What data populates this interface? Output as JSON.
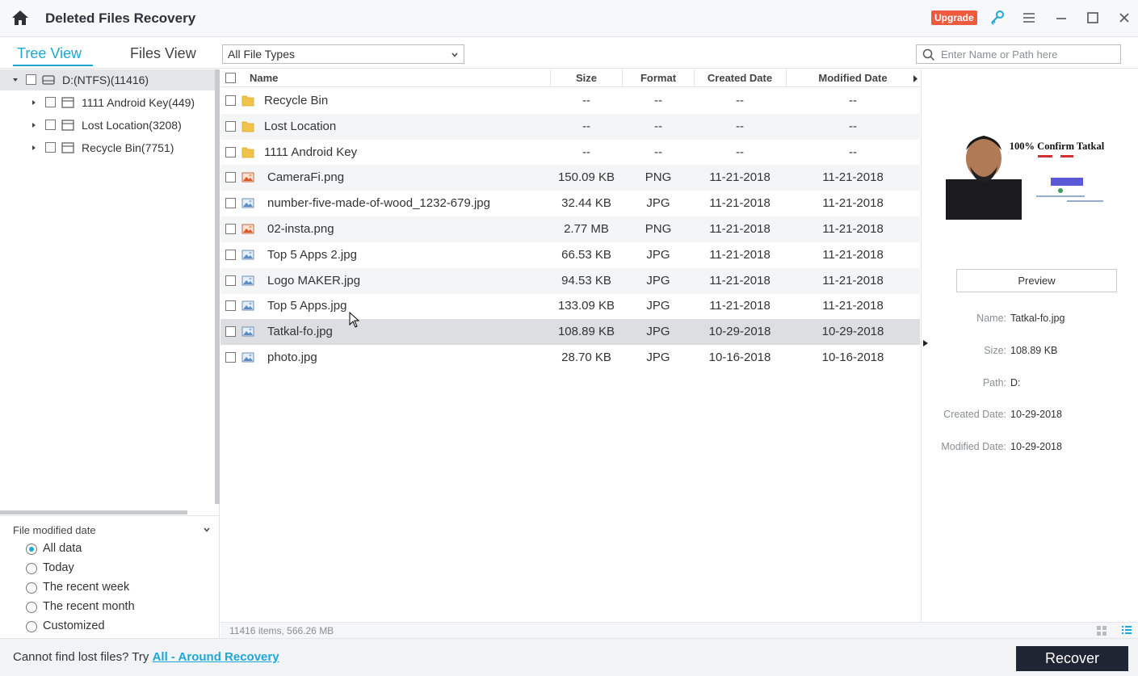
{
  "titlebar": {
    "title": "Deleted Files Recovery",
    "upgrade_label": "Upgrade",
    "icons": [
      "home-icon",
      "key-icon",
      "menu-icon",
      "minimize-icon",
      "maximize-icon",
      "close-icon"
    ]
  },
  "toolbar": {
    "tabs": [
      {
        "label": "Tree View",
        "active": true
      },
      {
        "label": "Files View",
        "active": false
      }
    ],
    "file_type_filter": "All File Types",
    "search_placeholder": "Enter Name or Path here"
  },
  "tree": [
    {
      "label": "D:(NTFS)(11416)",
      "expanded": true,
      "selected": true
    },
    {
      "label": "1111   Android Key(449)",
      "expanded": false
    },
    {
      "label": "Lost Location(3208)",
      "expanded": false
    },
    {
      "label": "Recycle Bin(7751)",
      "expanded": false
    }
  ],
  "filter": {
    "title": "File modified date",
    "options": [
      {
        "label": "All data",
        "selected": true
      },
      {
        "label": "Today",
        "selected": false
      },
      {
        "label": "The recent week",
        "selected": false
      },
      {
        "label": "The recent month",
        "selected": false
      },
      {
        "label": "Customized",
        "selected": false
      }
    ]
  },
  "list": {
    "columns": [
      "Name",
      "Size",
      "Format",
      "Created Date",
      "Modified Date"
    ],
    "rows": [
      {
        "name": "Recycle Bin",
        "size": "--",
        "format": "--",
        "created": "--",
        "modified": "--",
        "icon": "folder-icon"
      },
      {
        "name": "Lost Location",
        "size": "--",
        "format": "--",
        "created": "--",
        "modified": "--",
        "icon": "folder-icon"
      },
      {
        "name": "1111   Android Key",
        "size": "--",
        "format": "--",
        "created": "--",
        "modified": "--",
        "icon": "folder-icon"
      },
      {
        "name": "CameraFi.png",
        "size": "150.09 KB",
        "format": "PNG",
        "created": "11-21-2018",
        "modified": "11-21-2018",
        "icon": "png-image-icon"
      },
      {
        "name": "number-five-made-of-wood_1232-679.jpg",
        "size": "32.44 KB",
        "format": "JPG",
        "created": "11-21-2018",
        "modified": "11-21-2018",
        "icon": "jpg-image-icon"
      },
      {
        "name": "02-insta.png",
        "size": "2.77 MB",
        "format": "PNG",
        "created": "11-21-2018",
        "modified": "11-21-2018",
        "icon": "png-image-icon"
      },
      {
        "name": "Top 5 Apps 2.jpg",
        "size": "66.53 KB",
        "format": "JPG",
        "created": "11-21-2018",
        "modified": "11-21-2018",
        "icon": "jpg-image-icon"
      },
      {
        "name": "Logo MAKER.jpg",
        "size": "94.53 KB",
        "format": "JPG",
        "created": "11-21-2018",
        "modified": "11-21-2018",
        "icon": "jpg-image-icon"
      },
      {
        "name": "Top 5 Apps.jpg",
        "size": "133.09 KB",
        "format": "JPG",
        "created": "11-21-2018",
        "modified": "11-21-2018",
        "icon": "jpg-image-icon"
      },
      {
        "name": "Tatkal-fo.jpg",
        "size": "108.89 KB",
        "format": "JPG",
        "created": "10-29-2018",
        "modified": "10-29-2018",
        "icon": "jpg-image-icon",
        "selected": true
      },
      {
        "name": "photo.jpg",
        "size": "28.70 KB",
        "format": "JPG",
        "created": "10-16-2018",
        "modified": "10-16-2018",
        "icon": "jpg-image-icon"
      }
    ],
    "status": "11416 items, 566.26 MB"
  },
  "preview": {
    "thumbnail_text": "100% Confirm Tatkal",
    "button_label": "Preview",
    "meta": [
      {
        "key": "Name:",
        "value": "Tatkal-fo.jpg"
      },
      {
        "key": "Size:",
        "value": "108.89 KB"
      },
      {
        "key": "Path:",
        "value": "D:"
      },
      {
        "key": "Created Date:",
        "value": "10-29-2018"
      },
      {
        "key": "Modified Date:",
        "value": "10-29-2018"
      }
    ]
  },
  "footer": {
    "prompt": "Cannot find lost files? Try ",
    "link": "All - Around Recovery",
    "recover_label": "Recover"
  },
  "colors": {
    "accent": "#1ea7d6",
    "upgrade": "#ee5a3e",
    "recover_button": "#1f2532",
    "selected_row": "#dcdee2"
  }
}
